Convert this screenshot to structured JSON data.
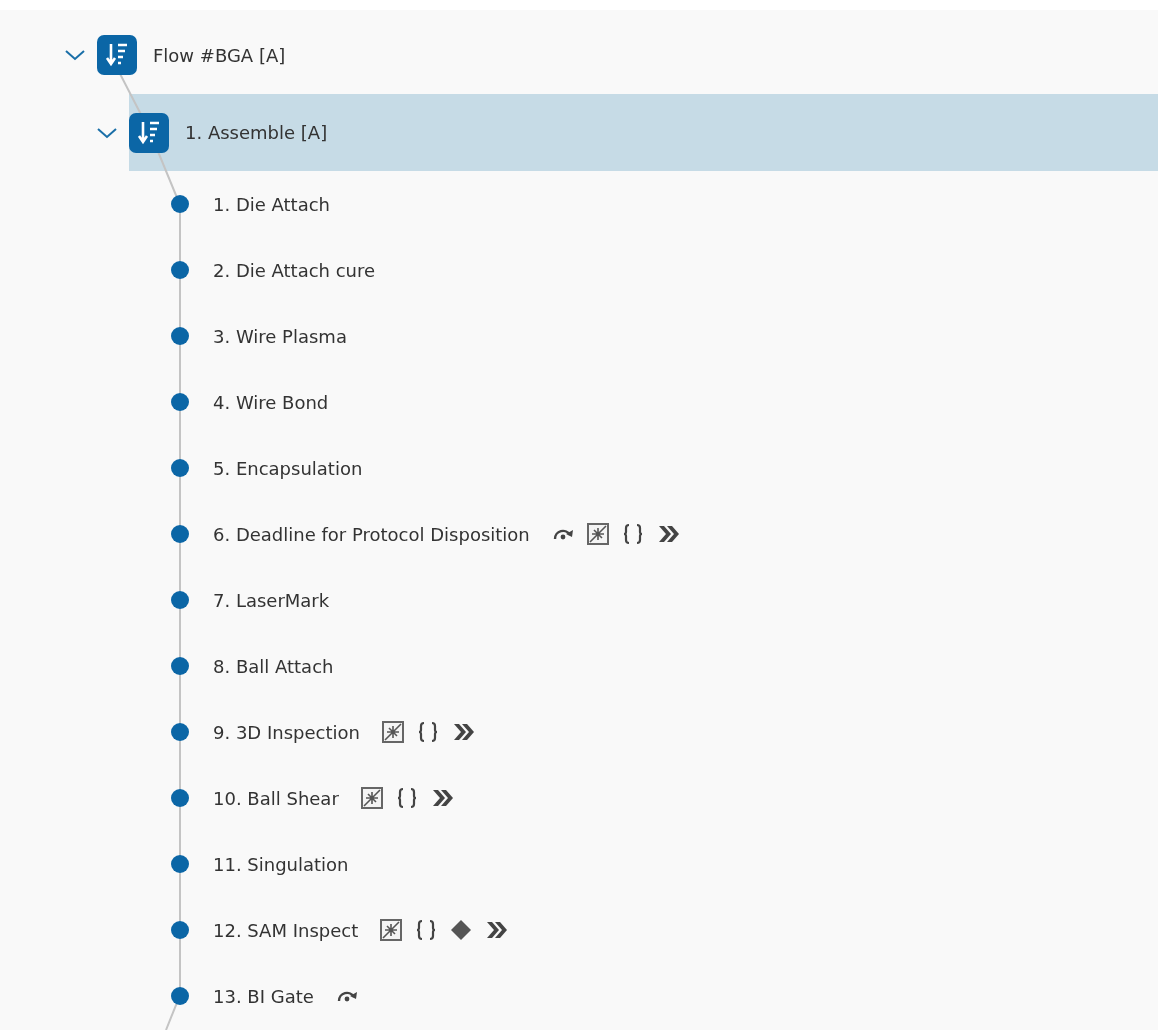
{
  "tree": [
    {
      "label": "Flow #BGA [A]",
      "expanded": true,
      "selected": false,
      "children": [
        {
          "label": "1. Assemble [A]",
          "expanded": true,
          "selected": true,
          "children": [
            {
              "label": "1. Die Attach",
              "selected": false
            },
            {
              "label": "2. Die Attach cure",
              "selected": false
            },
            {
              "label": "3. Wire Plasma",
              "selected": false
            },
            {
              "label": "4. Wire Bond",
              "selected": false
            },
            {
              "label": "5. Encapsulation",
              "selected": false
            },
            {
              "label": "6. Deadline for Protocol Disposition",
              "selected": false,
              "badges": [
                {
                  "kind": "skip"
                },
                {
                  "kind": "mask"
                },
                {
                  "kind": "braces"
                },
                {
                  "kind": "forward"
                }
              ]
            },
            {
              "label": "7. LaserMark",
              "selected": false
            },
            {
              "label": "8. Ball Attach",
              "selected": false
            },
            {
              "label": "9. 3D Inspection",
              "selected": false,
              "badges": [
                {
                  "kind": "mask"
                },
                {
                  "kind": "braces"
                },
                {
                  "kind": "forward"
                }
              ]
            },
            {
              "label": "10. Ball Shear",
              "selected": false,
              "badges": [
                {
                  "kind": "mask"
                },
                {
                  "kind": "braces"
                },
                {
                  "kind": "forward"
                }
              ]
            },
            {
              "label": "11. Singulation",
              "selected": false
            },
            {
              "label": "12. SAM Inspect",
              "selected": false,
              "badges": [
                {
                  "kind": "mask"
                },
                {
                  "kind": "braces"
                },
                {
                  "kind": "diamond"
                },
                {
                  "kind": "forward"
                }
              ]
            },
            {
              "label": "13. BI Gate",
              "selected": false,
              "badges": [
                {
                  "kind": "skip"
                }
              ]
            }
          ]
        }
      ]
    }
  ]
}
